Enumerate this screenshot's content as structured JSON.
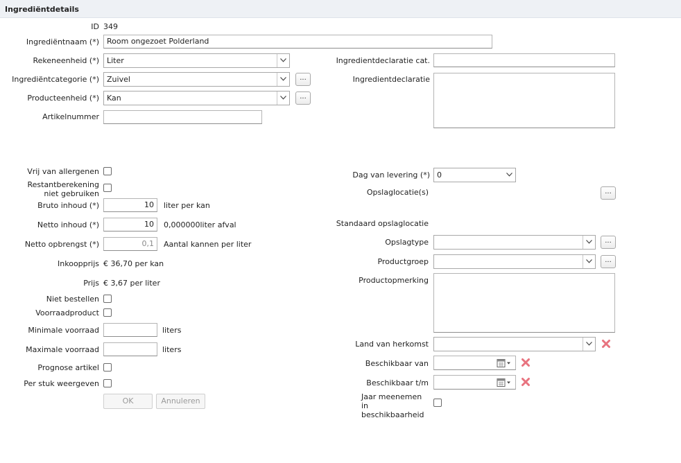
{
  "header": {
    "title": "Ingrediëntdetails"
  },
  "left": {
    "id_label": "ID",
    "id_value": "349",
    "name_label": "Ingrediëntnaam (*)",
    "name_value": "Room ongezoet Polderland",
    "rekeneenheid_label": "Rekeneenheid (*)",
    "rekeneenheid_value": "Liter",
    "categorie_label": "Ingrediëntcategorie (*)",
    "categorie_value": "Zuivel",
    "producteenheid_label": "Producteenheid (*)",
    "producteenheid_value": "Kan",
    "artikelnummer_label": "Artikelnummer",
    "artikelnummer_value": "",
    "allergenen_label": "Vrij van allergenen",
    "restant_label": "Restantberekening niet gebruiken",
    "bruto_label": "Bruto inhoud (*)",
    "bruto_value": "10",
    "bruto_unit": "liter per kan",
    "netto_label": "Netto inhoud (*)",
    "netto_value": "10",
    "netto_unit": "0,000000liter afval",
    "opbrengst_label": "Netto opbrengst (*)",
    "opbrengst_value": "0,1",
    "opbrengst_unit": "Aantal kannen per liter",
    "inkoopprijs_label": "Inkoopprijs",
    "inkoopprijs_value": "€ 36,70 per kan",
    "prijs_label": "Prijs",
    "prijs_value": "€ 3,67 per liter",
    "niet_bestellen_label": "Niet bestellen",
    "voorraadproduct_label": "Voorraadproduct",
    "min_voorraad_label": "Minimale voorraad",
    "min_voorraad_unit": "liters",
    "max_voorraad_label": "Maximale voorraad",
    "max_voorraad_unit": "liters",
    "prognose_label": "Prognose artikel",
    "per_stuk_label": "Per stuk weergeven",
    "ok_label": "OK",
    "annuleren_label": "Annuleren",
    "dots_label": "..."
  },
  "right": {
    "decl_cat_label": "Ingredientdeclaratie cat.",
    "decl_label": "Ingredientdeclaratie",
    "levering_label": "Dag van levering (*)",
    "levering_value": "0",
    "opslaglocaties_label": "Opslaglocatie(s)",
    "standaard_label": "Standaard opslaglocatie",
    "opslagtype_label": "Opslagtype",
    "productgroep_label": "Productgroep",
    "productopmerking_label": "Productopmerking",
    "land_label": "Land van herkomst",
    "beschikbaar_van_label": "Beschikbaar van",
    "beschikbaar_tm_label": "Beschikbaar t/m",
    "jaar_label": "Jaar meenemen in beschikbaarheid"
  },
  "colors": {
    "header_bg": "#eef1f5",
    "remove_icon": "#e8737f"
  },
  "icons": {
    "dropdown": "chevron-down-icon",
    "remove": "close-icon",
    "calendar": "calendar-icon"
  }
}
